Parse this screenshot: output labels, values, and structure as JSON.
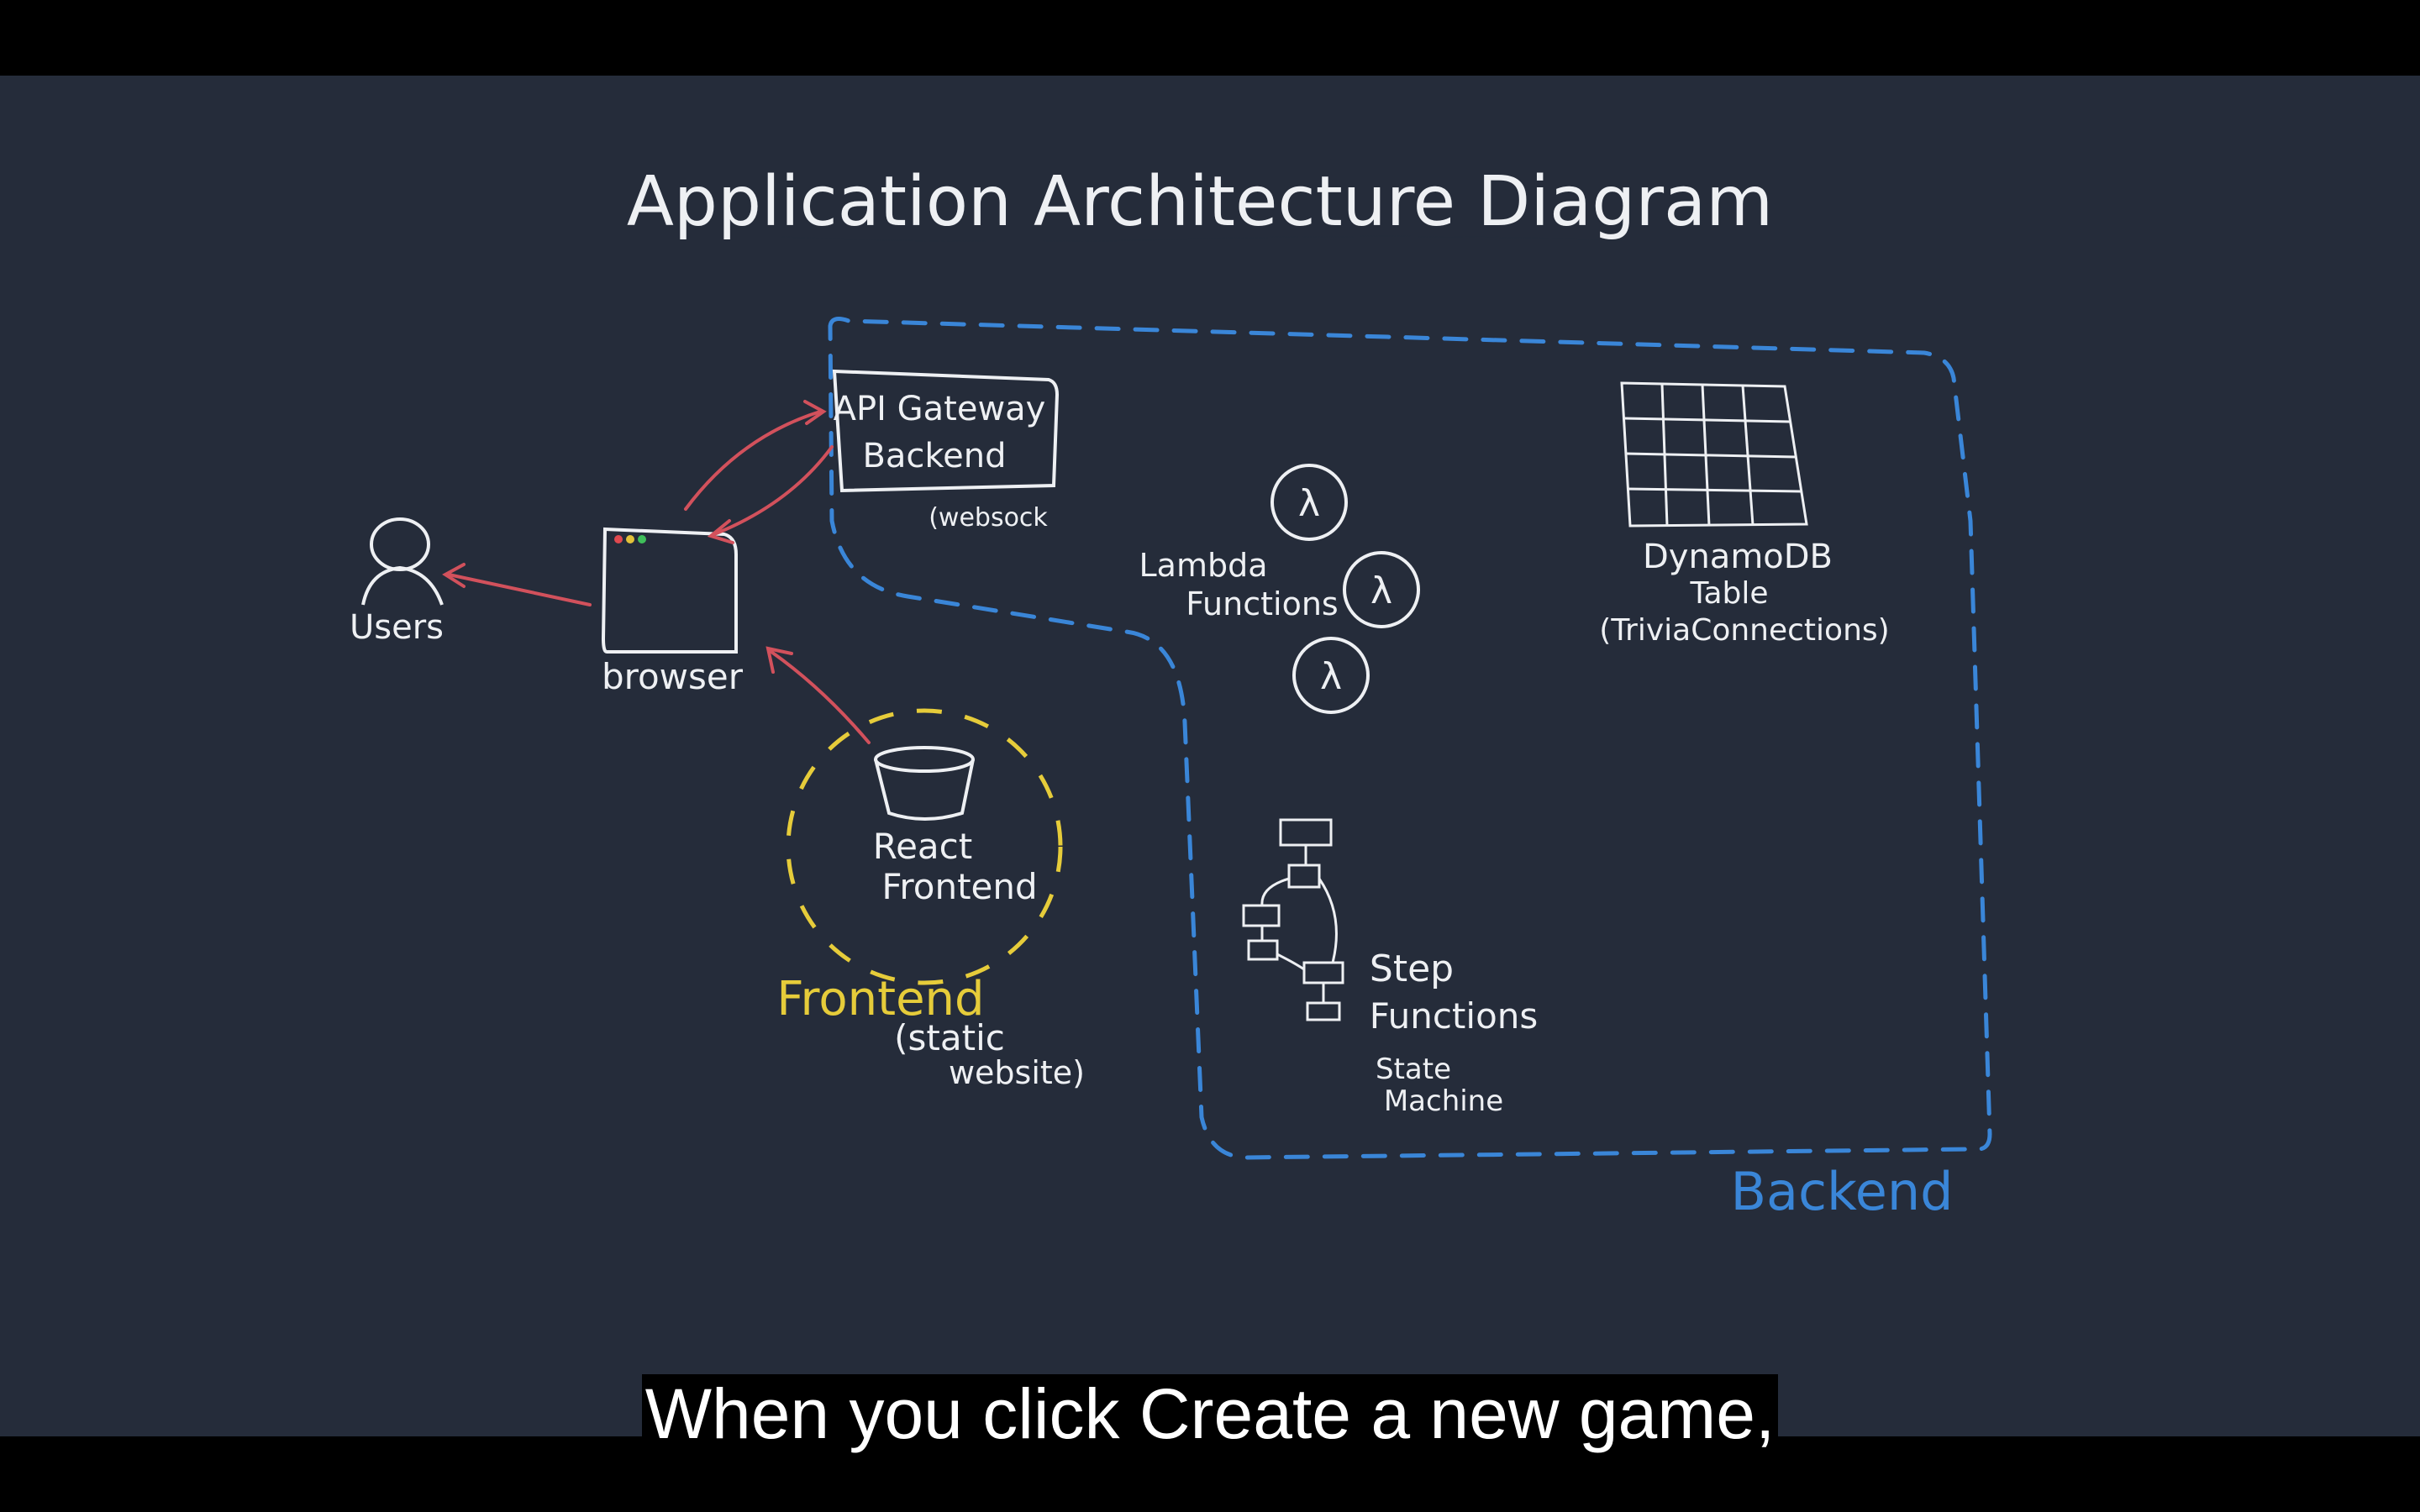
{
  "title": "Application Architecture Diagram",
  "nodes": {
    "users": "Users",
    "browser": "browser",
    "api_gateway": [
      "API Gateway",
      "Backend"
    ],
    "api_gateway_note": "(websock",
    "react_frontend": [
      "React",
      "Frontend"
    ],
    "frontend_group": "Frontend",
    "frontend_note": [
      "(static",
      "website)"
    ],
    "lambda": [
      "Lambda",
      "Functions"
    ],
    "lambda_symbol": "λ",
    "dynamodb": [
      "DynamoDB",
      "Table",
      "(TriviaConnections)"
    ],
    "step_functions": [
      "Step",
      "Functions"
    ],
    "state_machine": [
      "State",
      "Machine"
    ],
    "backend_group": "Backend"
  },
  "colors": {
    "background": "#252c3a",
    "chalk": "#eef0f3",
    "arrow": "#d2515c",
    "backend_boundary": "#3a86d8",
    "frontend_boundary": "#e6cc3a"
  },
  "caption": "When you click Create a new game,"
}
